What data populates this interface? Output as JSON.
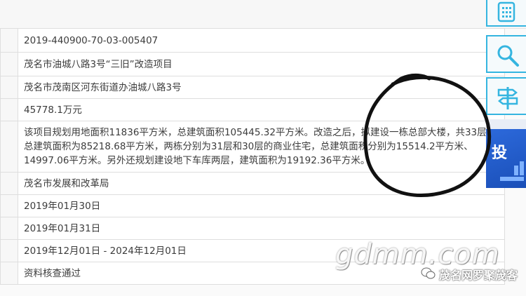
{
  "rows": [
    {
      "value": "2019-440900-70-03-005407"
    },
    {
      "value": "茂名市油城八路3号“三旧”改造项目"
    },
    {
      "value": "茂名市茂南区河东街道办油城八路3号"
    },
    {
      "value": "45778.1万元"
    },
    {
      "value": "该项目规划用地面积11836平方米，总建筑面积105445.32平方米。改造之后，拟建设一栋总部大楼，共33层，总建筑面积为85218.68平方米，两栋分别为31层和30层的商业住宅，总建筑面积分别为15514.2平方米、14997.06平方米。另外还规划建设地下车库两层，建筑面积为19192.36平方米。"
    },
    {
      "value": "茂名市发展和改革局"
    },
    {
      "value": "2019年01月30日"
    },
    {
      "value": "2019年01月31日"
    },
    {
      "value": "2019年12月01日 - 2024年12月01日"
    },
    {
      "value": "资料核查通过"
    }
  ],
  "sidebar": {
    "banner_text": "投"
  },
  "watermark": {
    "text": "gdmm.com",
    "wechat": "茂名网罗聚茂客"
  },
  "colors": {
    "accent": "#35b5e0",
    "banner": "#2f6de0",
    "ink": "#111111"
  },
  "icons": [
    "list-icon",
    "search-icon",
    "signpost-icon",
    "wechat-icon"
  ]
}
